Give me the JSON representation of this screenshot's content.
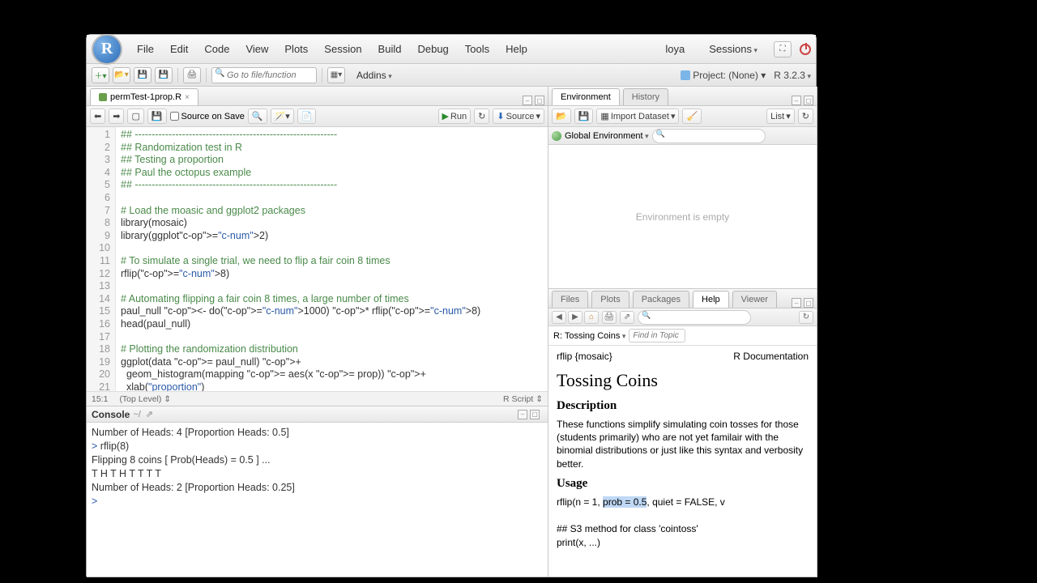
{
  "menubar": {
    "items": [
      "File",
      "Edit",
      "Code",
      "View",
      "Plots",
      "Session",
      "Build",
      "Debug",
      "Tools",
      "Help"
    ],
    "user": "loya",
    "sessions": "Sessions"
  },
  "toolbar": {
    "goto_placeholder": "Go to file/function",
    "addins": "Addins",
    "project": "Project: (None)",
    "r_version": "R 3.2.3"
  },
  "source": {
    "tab": "permTest-1prop.R",
    "source_on_save": "Source on Save",
    "run": "Run",
    "source_btn": "Source",
    "status_pos": "15:1",
    "status_scope": "(Top Level)",
    "status_type": "R Script",
    "lines": [
      {
        "n": "1",
        "fold": "▾",
        "t": "## ------------------------------------------------------------",
        "cls": "c-comment"
      },
      {
        "n": "2",
        "t": "## Randomization test in R",
        "cls": "c-comment"
      },
      {
        "n": "3",
        "t": "## Testing a proportion",
        "cls": "c-comment"
      },
      {
        "n": "4",
        "t": "## Paul the octopus example",
        "cls": "c-comment"
      },
      {
        "n": "5",
        "fold": "▾",
        "t": "## ------------------------------------------------------------",
        "cls": "c-comment"
      },
      {
        "n": "6",
        "t": ""
      },
      {
        "n": "7",
        "t": "# Load the moasic and ggplot2 packages",
        "cls": "c-comment"
      },
      {
        "n": "8",
        "t": "library(mosaic)"
      },
      {
        "n": "9",
        "t": "library(ggplot2)"
      },
      {
        "n": "10",
        "t": ""
      },
      {
        "n": "11",
        "t": "# To simulate a single trial, we need to flip a fair coin 8 times",
        "cls": "c-comment"
      },
      {
        "n": "12",
        "t": "rflip(8)"
      },
      {
        "n": "13",
        "t": ""
      },
      {
        "n": "14",
        "t": "# Automating flipping a fair coin 8 times, a large number of times",
        "cls": "c-comment"
      },
      {
        "n": "15",
        "t": "paul_null <- do(1000) * rflip(8)"
      },
      {
        "n": "16",
        "t": "head(paul_null)"
      },
      {
        "n": "17",
        "t": ""
      },
      {
        "n": "18",
        "t": "# Plotting the randomization distribution",
        "cls": "c-comment"
      },
      {
        "n": "19",
        "t": "ggplot(data = paul_null) +"
      },
      {
        "n": "20",
        "t": "  geom_histogram(mapping = aes(x = prop)) +"
      },
      {
        "n": "21",
        "t": "  xlab(\"proportion\")"
      }
    ]
  },
  "console": {
    "title": "Console",
    "path": "~/",
    "lines": [
      "Number of Heads: 4 [Proportion Heads: 0.5]",
      "",
      "> rflip(8)",
      "",
      "Flipping 8 coins [ Prob(Heads) = 0.5 ] ...",
      "",
      "T H T H T T T T",
      "",
      "Number of Heads: 2 [Proportion Heads: 0.25]",
      "",
      "> "
    ]
  },
  "env": {
    "tabs": [
      "Environment",
      "History"
    ],
    "import": "Import Dataset",
    "list": "List",
    "scope": "Global Environment",
    "empty": "Environment is empty"
  },
  "help": {
    "tabs": [
      "Files",
      "Plots",
      "Packages",
      "Help",
      "Viewer"
    ],
    "topic": "R: Tossing Coins",
    "find_placeholder": "Find in Topic",
    "sig_left": "rflip {mosaic}",
    "sig_right": "R Documentation",
    "title": "Tossing Coins",
    "h_desc": "Description",
    "desc": "These functions simplify simulating coin tosses for those (students primarily) who are not yet familair with the binomial distributions or just like this syntax and verbosity better.",
    "h_usage": "Usage",
    "usage_pre": "rflip(n = 1, ",
    "usage_hl": "prob = 0.5",
    "usage_post": ", quiet = FALSE, v",
    "usage2": "## S3 method for class 'cointoss'",
    "usage3": "print(x, ...)"
  }
}
